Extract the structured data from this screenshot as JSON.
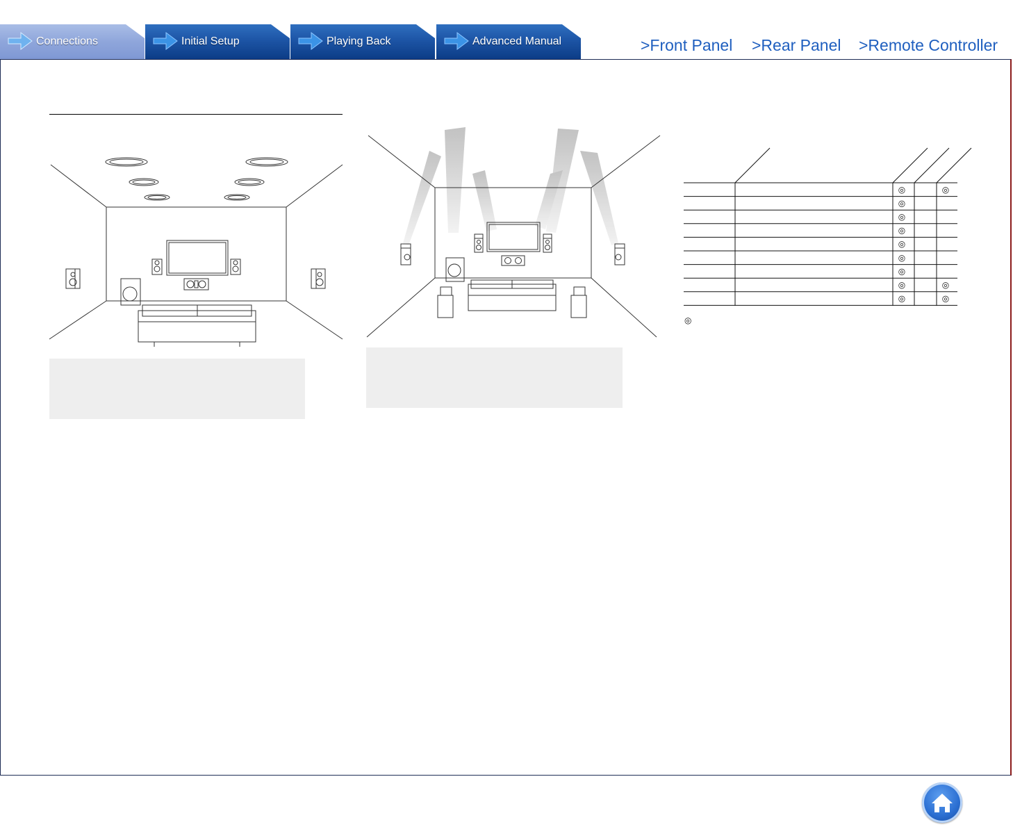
{
  "nav": {
    "tabs": [
      {
        "label": "Connections",
        "active": true
      },
      {
        "label": "Initial Setup",
        "active": false
      },
      {
        "label": "Playing Back",
        "active": false
      },
      {
        "label": "Advanced Manual",
        "active": false
      }
    ],
    "links": [
      ">Front Panel",
      ">Rear Panel",
      ">Remote Controller"
    ]
  },
  "table": {
    "mark_symbol": "◎",
    "rows": [
      {
        "col1": true,
        "col2": false,
        "col3": true
      },
      {
        "col1": true,
        "col2": false,
        "col3": false
      },
      {
        "col1": true,
        "col2": false,
        "col3": false
      },
      {
        "col1": true,
        "col2": false,
        "col3": false
      },
      {
        "col1": true,
        "col2": false,
        "col3": false
      },
      {
        "col1": true,
        "col2": false,
        "col3": false
      },
      {
        "col1": true,
        "col2": false,
        "col3": false
      },
      {
        "col1": true,
        "col2": false,
        "col3": true
      },
      {
        "col1": true,
        "col2": false,
        "col3": true
      }
    ]
  },
  "colors": {
    "tab_active": "#8fa6db",
    "tab_inactive": "#1d55a6",
    "link": "#1f5fbf",
    "frame_right_border": "#8b1a1a",
    "info_box": "#eeeeee"
  },
  "icons": {
    "tab_arrow": "arrow-right-icon",
    "home": "home-icon"
  }
}
